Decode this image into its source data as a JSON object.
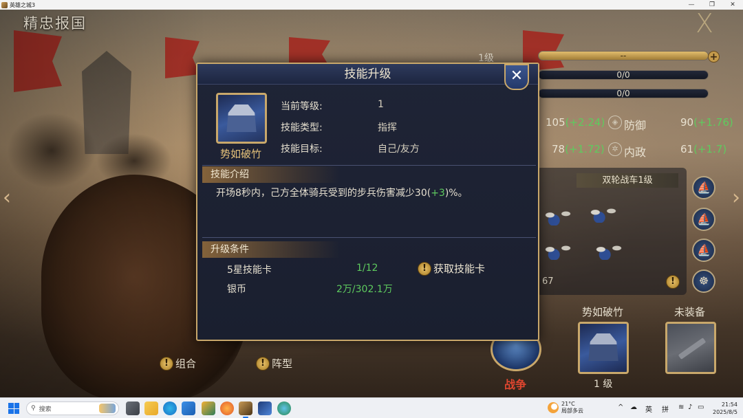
{
  "window": {
    "title": "英雄之城3"
  },
  "page": {
    "title": "精忠报国",
    "close_glyph": "X"
  },
  "hero_panel": {
    "level": "1级",
    "exp_bar": "--",
    "bar2": "0/0",
    "bar3": "0/0",
    "stats": [
      {
        "value": "105",
        "bonus": "(+2.24)",
        "name": "防御",
        "value2": "90",
        "bonus2": "(+1.76)"
      },
      {
        "value": "78",
        "bonus": "(+1.72)",
        "name": "内政",
        "value2": "61",
        "bonus2": "(+1.7)"
      }
    ],
    "troop_name": "双轮战车1级",
    "troop_count": "67",
    "slots": [
      {
        "label": "势如破竹",
        "level": "1 级"
      },
      {
        "label": "未装备"
      }
    ],
    "war_label": "战争"
  },
  "bottom_actions": {
    "combo": "组合",
    "formation": "阵型"
  },
  "dialog": {
    "title": "技能升级",
    "close_glyph": "✕",
    "skill_name": "势如破竹",
    "info": [
      {
        "label": "当前等级:",
        "value": "1"
      },
      {
        "label": "技能类型:",
        "value": "指挥"
      },
      {
        "label": "技能目标:",
        "value": "自己/友方"
      }
    ],
    "intro_tab": "技能介绍",
    "description_prefix": "开场8秒内，己方全体骑兵受到的步兵伤害减少30(",
    "description_bonus": "+3",
    "description_suffix": ")%。",
    "conditions_tab": "升级条件",
    "conditions": [
      {
        "label": "5星技能卡",
        "value": "1/12"
      },
      {
        "label": "银币",
        "value": "2万/302.1万"
      }
    ],
    "get_card": "获取技能卡"
  },
  "taskbar": {
    "search_placeholder": "搜索",
    "weather_temp": "21°C",
    "weather_desc": "局部多云",
    "weather_badge": "9+",
    "ime": "英",
    "ime2": "拼",
    "time": "21:54",
    "date": "2025/8/5"
  },
  "colors": {
    "accent_gold": "#c9a86b",
    "bonus_green": "#5ecb5e",
    "war_red": "#e0462f"
  }
}
